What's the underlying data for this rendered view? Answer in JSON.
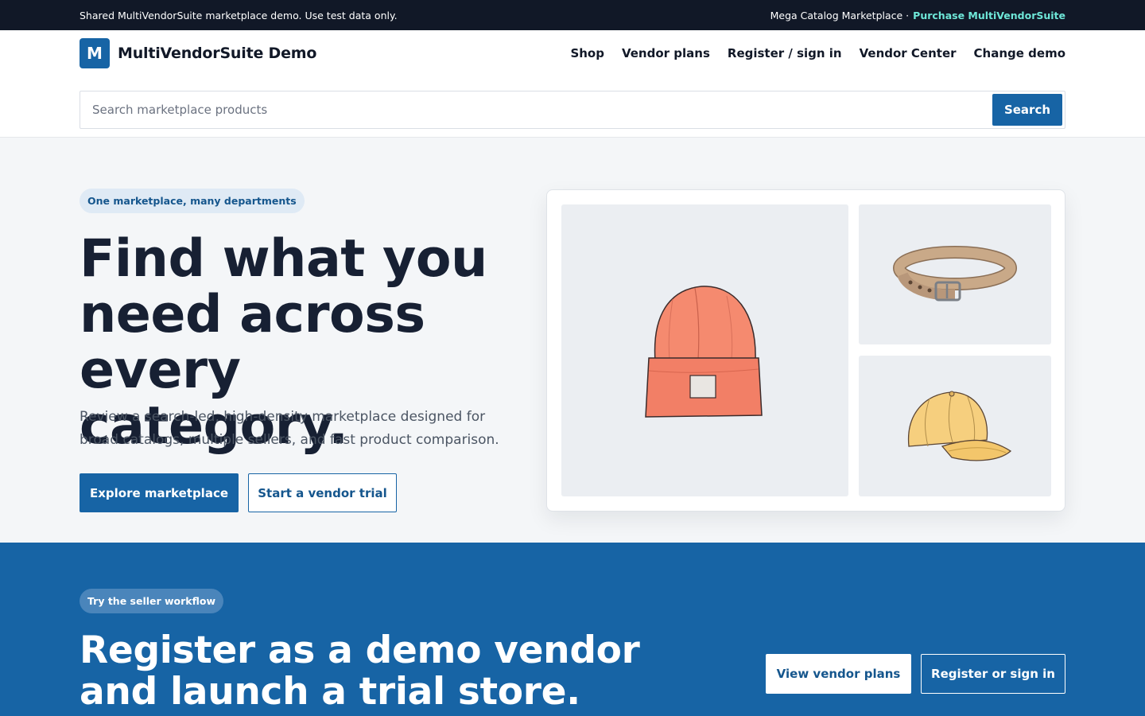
{
  "topbar": {
    "notice": "Shared MultiVendorSuite marketplace demo. Use test data only.",
    "catalog_label": "Mega Catalog Marketplace ·",
    "purchase_link": "Purchase MultiVendorSuite"
  },
  "header": {
    "logo_letter": "M",
    "brand": "MultiVendorSuite Demo",
    "nav": [
      "Shop",
      "Vendor plans",
      "Register / sign in",
      "Vendor Center",
      "Change demo"
    ]
  },
  "search": {
    "placeholder": "Search marketplace products",
    "value": "",
    "button_label": "Search"
  },
  "hero": {
    "eyebrow": "One marketplace, many departments",
    "headline": "Find what you need across every category.",
    "description": "Review a search-led, high-density marketplace designed for broad catalogs, multiple sellers, and fast product comparison.",
    "primary_cta": "Explore marketplace",
    "secondary_cta": "Start a vendor trial",
    "gallery": [
      {
        "icon": "beanie-image"
      },
      {
        "icon": "belt-image"
      },
      {
        "icon": "cap-image"
      }
    ]
  },
  "vendor": {
    "eyebrow": "Try the seller workflow",
    "headline": "Register as a demo vendor and launch a trial store.",
    "plans_cta": "View vendor plans",
    "register_cta": "Register or sign in"
  },
  "colors": {
    "brand_blue": "#1764a5",
    "dark_bar": "#111827",
    "accent_teal": "#6ee7d8",
    "hero_bg": "#f4f6f8"
  }
}
